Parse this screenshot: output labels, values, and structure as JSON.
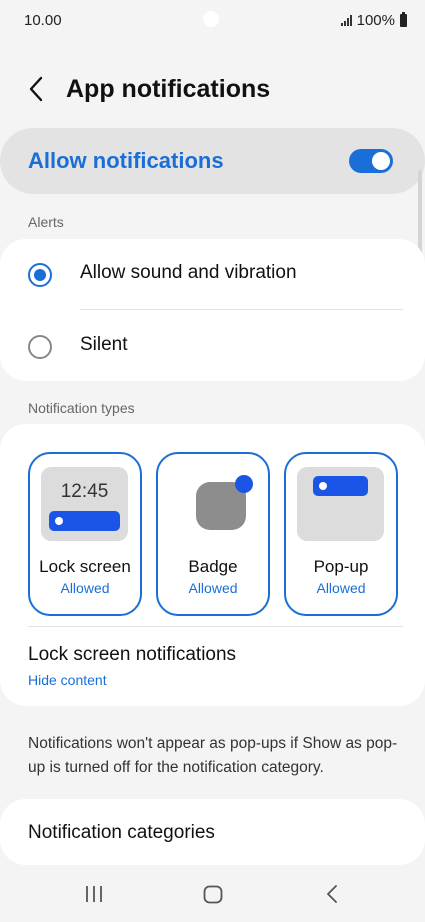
{
  "status_bar": {
    "time": "10.00",
    "battery": "100%",
    "icons": [
      "signal-icon",
      "battery-icon"
    ]
  },
  "header": {
    "title": "App notifications",
    "back_icon": "back-arrow-icon"
  },
  "allow_notifications": {
    "label": "Allow notifications",
    "enabled": true
  },
  "alerts": {
    "section_label": "Alerts",
    "options": [
      {
        "label": "Allow sound and vibration",
        "selected": true
      },
      {
        "label": "Silent",
        "selected": false
      }
    ]
  },
  "notification_types": {
    "section_label": "Notification types",
    "tiles": [
      {
        "name": "Lock screen",
        "status": "Allowed",
        "preview_time": "12:45"
      },
      {
        "name": "Badge",
        "status": "Allowed"
      },
      {
        "name": "Pop-up",
        "status": "Allowed"
      }
    ],
    "lock_screen_notifications": {
      "title": "Lock screen notifications",
      "value": "Hide content"
    }
  },
  "info_text": "Notifications won't appear as pop-ups if Show as pop-up is turned off for the notification category.",
  "notification_categories": {
    "label": "Notification categories"
  },
  "nav_bar": {
    "icons": [
      "recents-icon",
      "home-icon",
      "back-icon"
    ]
  },
  "colors": {
    "accent": "#1a6ed8",
    "background": "#f4f4f4",
    "card": "#ffffff"
  }
}
